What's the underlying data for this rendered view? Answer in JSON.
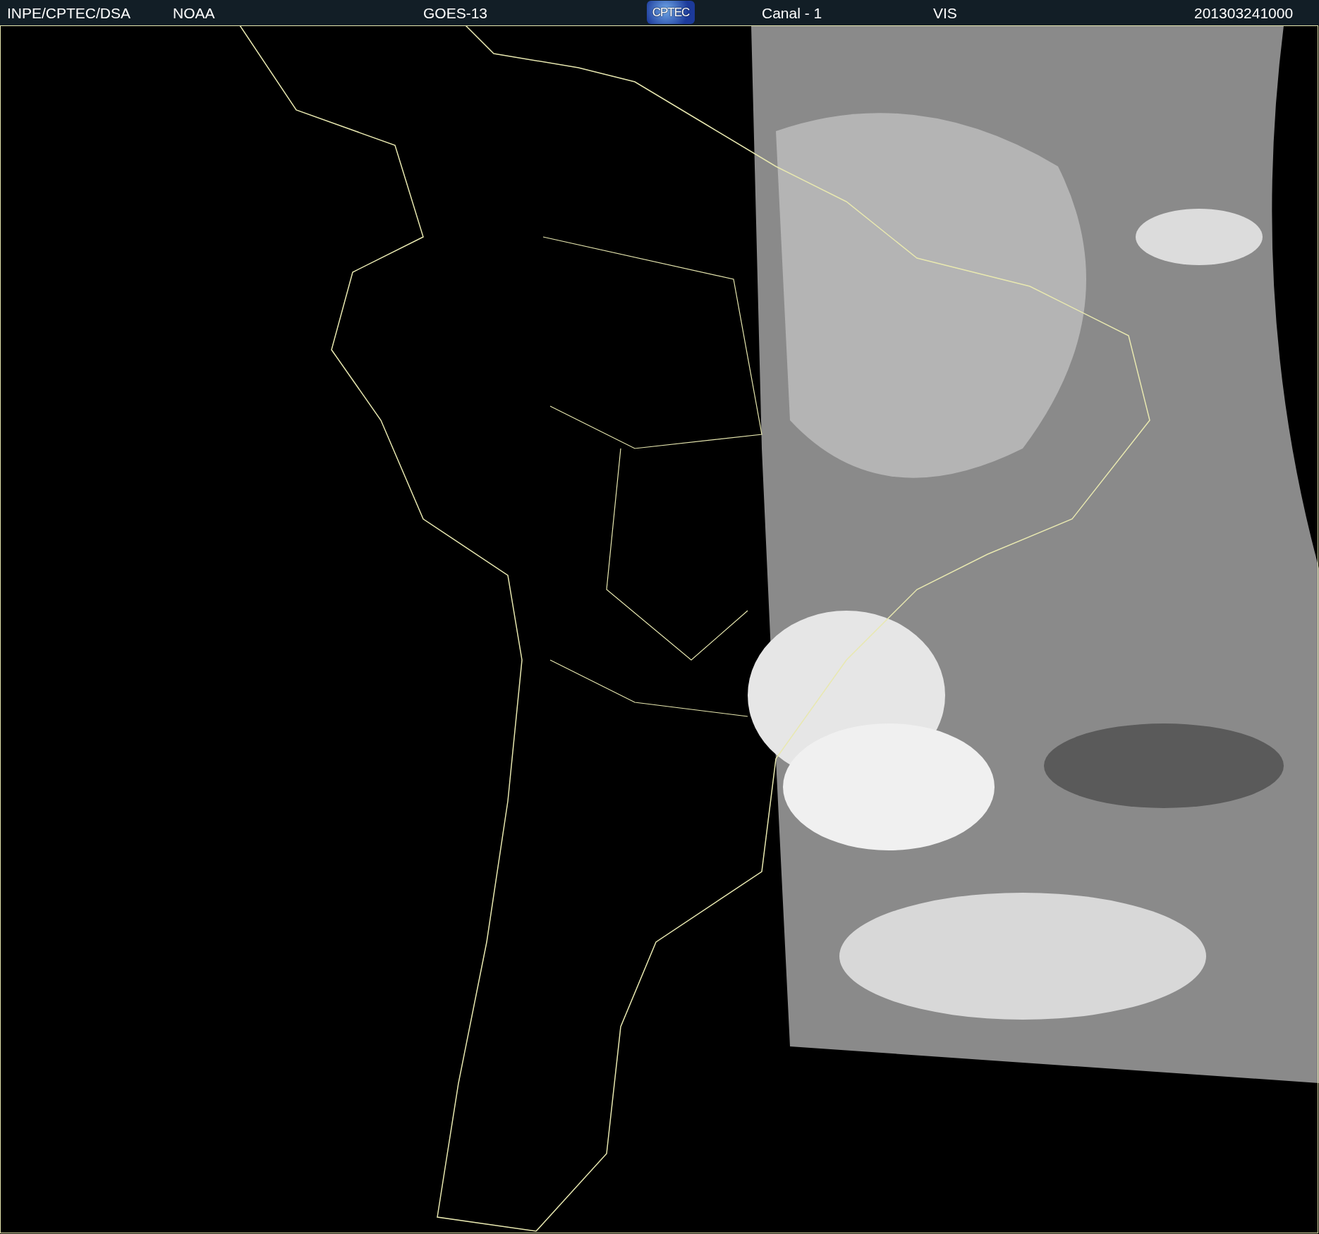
{
  "header": {
    "items": [
      {
        "kind": "text",
        "text": "INPE/CPTEC/DSA"
      },
      {
        "kind": "text",
        "text": "NOAA"
      },
      {
        "kind": "text",
        "text": "GOES-13"
      },
      {
        "kind": "logo",
        "text": "CPTEC"
      },
      {
        "kind": "text",
        "text": "Canal - 1"
      },
      {
        "kind": "text",
        "text": "VIS"
      },
      {
        "kind": "text",
        "text": "201303241000"
      }
    ]
  }
}
